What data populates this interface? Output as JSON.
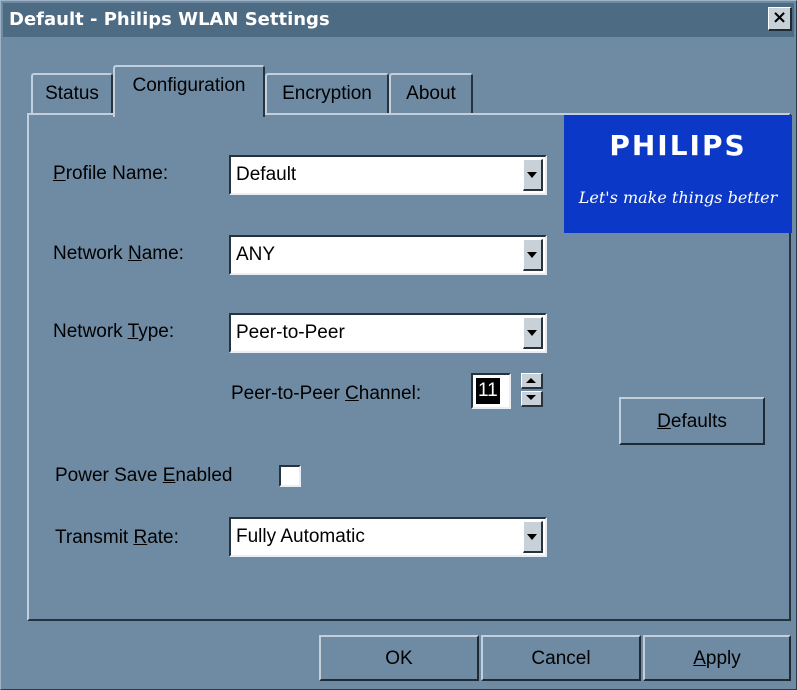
{
  "window": {
    "title": "Default - Philips WLAN Settings",
    "close_glyph": "×"
  },
  "tabs": [
    {
      "label": "Status",
      "active": false
    },
    {
      "label": "Configuration",
      "active": true
    },
    {
      "label": "Encryption",
      "active": false
    },
    {
      "label": "About",
      "active": false
    }
  ],
  "form": {
    "profile_name": {
      "label_pre": "",
      "label_u": "P",
      "label_post": "rofile Name:",
      "value": "Default"
    },
    "network_name": {
      "label_pre": "Network ",
      "label_u": "N",
      "label_post": "ame:",
      "value": "ANY"
    },
    "network_type": {
      "label_pre": "Network ",
      "label_u": "T",
      "label_post": "ype:",
      "value": "Peer-to-Peer"
    },
    "channel": {
      "label_pre": "Peer-to-Peer ",
      "label_u": "C",
      "label_post": "hannel:",
      "value": "11"
    },
    "power_save": {
      "label_pre": "Power Save ",
      "label_u": "E",
      "label_post": "nabled",
      "checked": false
    },
    "transmit_rate": {
      "label_pre": "Transmit ",
      "label_u": "R",
      "label_post": "ate:",
      "value": "Fully Automatic"
    }
  },
  "logo": {
    "brand": "PHILIPS",
    "tagline": "Let's make things better",
    "color": "#0b38c6"
  },
  "buttons": {
    "defaults": {
      "u": "D",
      "rest": "efaults"
    },
    "ok": "OK",
    "cancel": "Cancel",
    "apply": {
      "u": "A",
      "rest": "pply"
    }
  },
  "icons": {
    "dropdown": "chevron-down-icon",
    "spin_up": "spin-up-icon",
    "spin_down": "spin-down-icon"
  }
}
